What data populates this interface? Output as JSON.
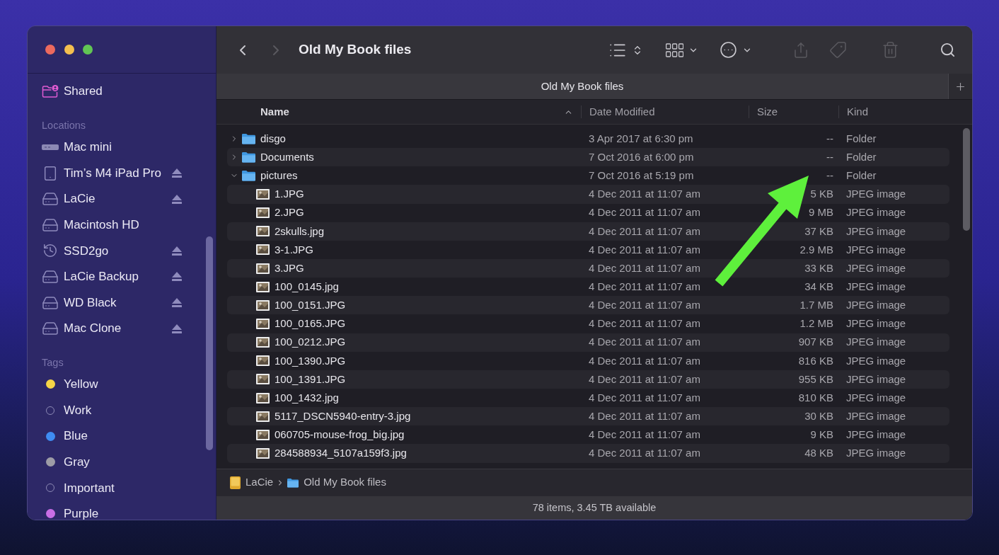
{
  "sidebar": {
    "items": [
      {
        "label": "Shared",
        "kind": "shared"
      }
    ],
    "sections": [
      {
        "heading": "Locations",
        "items": [
          {
            "label": "Mac mini",
            "kind": "computer",
            "ejectable": false
          },
          {
            "label": "Tim’s M4 iPad Pro",
            "kind": "tablet",
            "ejectable": true
          },
          {
            "label": "LaCie",
            "kind": "drive",
            "ejectable": true
          },
          {
            "label": "Macintosh HD",
            "kind": "drive",
            "ejectable": false
          },
          {
            "label": "SSD2go",
            "kind": "backup",
            "ejectable": true
          },
          {
            "label": "LaCie Backup",
            "kind": "drive",
            "ejectable": true
          },
          {
            "label": "WD Black",
            "kind": "drive",
            "ejectable": true
          },
          {
            "label": "Mac Clone",
            "kind": "drive",
            "ejectable": true
          }
        ]
      },
      {
        "heading": "Tags",
        "items": [
          {
            "label": "Yellow",
            "kind": "dot",
            "color": "#f5d547"
          },
          {
            "label": "Work",
            "kind": "ring"
          },
          {
            "label": "Blue",
            "kind": "dot",
            "color": "#3f8cf2"
          },
          {
            "label": "Gray",
            "kind": "dot",
            "color": "#9d9ca6"
          },
          {
            "label": "Important",
            "kind": "ring"
          },
          {
            "label": "Purple",
            "kind": "dot",
            "color": "#c96ee6"
          }
        ]
      }
    ]
  },
  "toolbar": {
    "back": {
      "disabled": false
    },
    "forward": {
      "disabled": true
    },
    "title": "Old My Book files",
    "actions": [
      {
        "kind": "view-list",
        "disabled": false
      },
      {
        "kind": "group",
        "disabled": false
      },
      {
        "kind": "more",
        "disabled": false
      },
      {
        "kind": "share",
        "disabled": true
      },
      {
        "kind": "tag",
        "disabled": true
      },
      {
        "kind": "delete",
        "disabled": true
      },
      {
        "kind": "search",
        "disabled": false
      }
    ]
  },
  "tabs": [
    {
      "label": "Old My Book files",
      "selected": true
    }
  ],
  "table": {
    "columns": [
      {
        "label": "Name",
        "sorted": true
      },
      {
        "label": "Date Modified",
        "sorted": false
      },
      {
        "label": "Size",
        "sorted": false
      },
      {
        "label": "Kind",
        "sorted": false
      }
    ],
    "rows": [
      {
        "kind": "folder",
        "name": "disgo",
        "date_modified": "3 Apr 2017 at 6:30 pm",
        "size": "--",
        "kind_label": "Folder",
        "expanded": false
      },
      {
        "kind": "folder",
        "name": "Documents",
        "date_modified": "7 Oct 2016 at 6:00 pm",
        "size": "--",
        "kind_label": "Folder",
        "expanded": false
      },
      {
        "kind": "folder",
        "name": "pictures",
        "date_modified": "7 Oct 2016 at 5:19 pm",
        "size": "--",
        "kind_label": "Folder",
        "expanded": true,
        "children": [
          {
            "kind": "image",
            "name": "1.JPG",
            "date_modified": "4 Dec 2011 at 11:07 am",
            "size": "5 KB",
            "kind_label": "JPEG image"
          },
          {
            "kind": "image",
            "name": "2.JPG",
            "date_modified": "4 Dec 2011 at 11:07 am",
            "size": "9 MB",
            "kind_label": "JPEG image"
          },
          {
            "kind": "image",
            "name": "2skulls.jpg",
            "date_modified": "4 Dec 2011 at 11:07 am",
            "size": "37 KB",
            "kind_label": "JPEG image"
          },
          {
            "kind": "image",
            "name": "3-1.JPG",
            "date_modified": "4 Dec 2011 at 11:07 am",
            "size": "2.9 MB",
            "kind_label": "JPEG image"
          },
          {
            "kind": "image",
            "name": "3.JPG",
            "date_modified": "4 Dec 2011 at 11:07 am",
            "size": "33 KB",
            "kind_label": "JPEG image"
          },
          {
            "kind": "image",
            "name": "100_0145.jpg",
            "date_modified": "4 Dec 2011 at 11:07 am",
            "size": "34 KB",
            "kind_label": "JPEG image"
          },
          {
            "kind": "image",
            "name": "100_0151.JPG",
            "date_modified": "4 Dec 2011 at 11:07 am",
            "size": "1.7 MB",
            "kind_label": "JPEG image"
          },
          {
            "kind": "image",
            "name": "100_0165.JPG",
            "date_modified": "4 Dec 2011 at 11:07 am",
            "size": "1.2 MB",
            "kind_label": "JPEG image"
          },
          {
            "kind": "image",
            "name": "100_0212.JPG",
            "date_modified": "4 Dec 2011 at 11:07 am",
            "size": "907 KB",
            "kind_label": "JPEG image"
          },
          {
            "kind": "image",
            "name": "100_1390.JPG",
            "date_modified": "4 Dec 2011 at 11:07 am",
            "size": "816 KB",
            "kind_label": "JPEG image"
          },
          {
            "kind": "image",
            "name": "100_1391.JPG",
            "date_modified": "4 Dec 2011 at 11:07 am",
            "size": "955 KB",
            "kind_label": "JPEG image"
          },
          {
            "kind": "image",
            "name": "100_1432.jpg",
            "date_modified": "4 Dec 2011 at 11:07 am",
            "size": "810 KB",
            "kind_label": "JPEG image"
          },
          {
            "kind": "image",
            "name": "5117_DSCN5940-entry-3.jpg",
            "date_modified": "4 Dec 2011 at 11:07 am",
            "size": "30 KB",
            "kind_label": "JPEG image"
          },
          {
            "kind": "image",
            "name": "060705-mouse-frog_big.jpg",
            "date_modified": "4 Dec 2011 at 11:07 am",
            "size": "9 KB",
            "kind_label": "JPEG image"
          },
          {
            "kind": "image",
            "name": "284588934_5107a159f3.jpg",
            "date_modified": "4 Dec 2011 at 11:07 am",
            "size": "48 KB",
            "kind_label": "JPEG image"
          }
        ]
      }
    ]
  },
  "path_bar": [
    {
      "label": "LaCie",
      "kind": "drive"
    },
    {
      "label": "Old My Book files",
      "kind": "folder"
    }
  ],
  "status_bar": {
    "text": "78 items, 3.45 TB available"
  }
}
